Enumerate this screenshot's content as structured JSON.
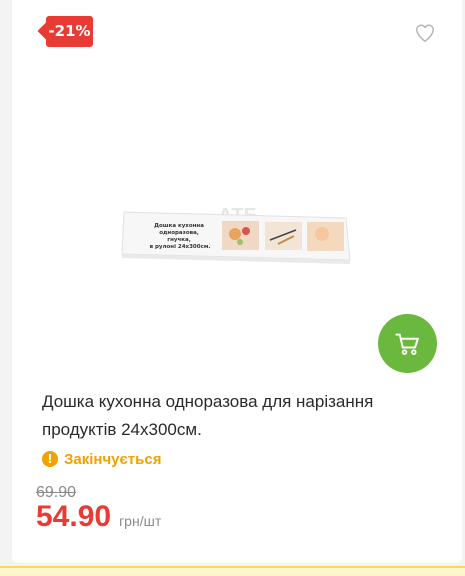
{
  "product": {
    "discount_badge": "-21%",
    "title": "Дошка кухонна одноразова для нарізання продуктів 24х300см.",
    "status": "Закінчується",
    "old_price": "69.90",
    "new_price": "54.90",
    "unit": "грн/шт",
    "image": {
      "watermark": "АТБ",
      "box_text": [
        "Дошка кухонна",
        "одноразова,",
        "гнучка,",
        "в рулоні 24х300см."
      ]
    }
  },
  "icons": {
    "favorite": "heart-outline-icon",
    "cart": "shopping-cart-icon",
    "status": "exclamation-icon"
  },
  "colors": {
    "badge": "#e93b33",
    "price": "#e93b33",
    "cart_button": "#6ab83e",
    "status": "#f2a100",
    "bottom_strip": "#ffd84a"
  }
}
